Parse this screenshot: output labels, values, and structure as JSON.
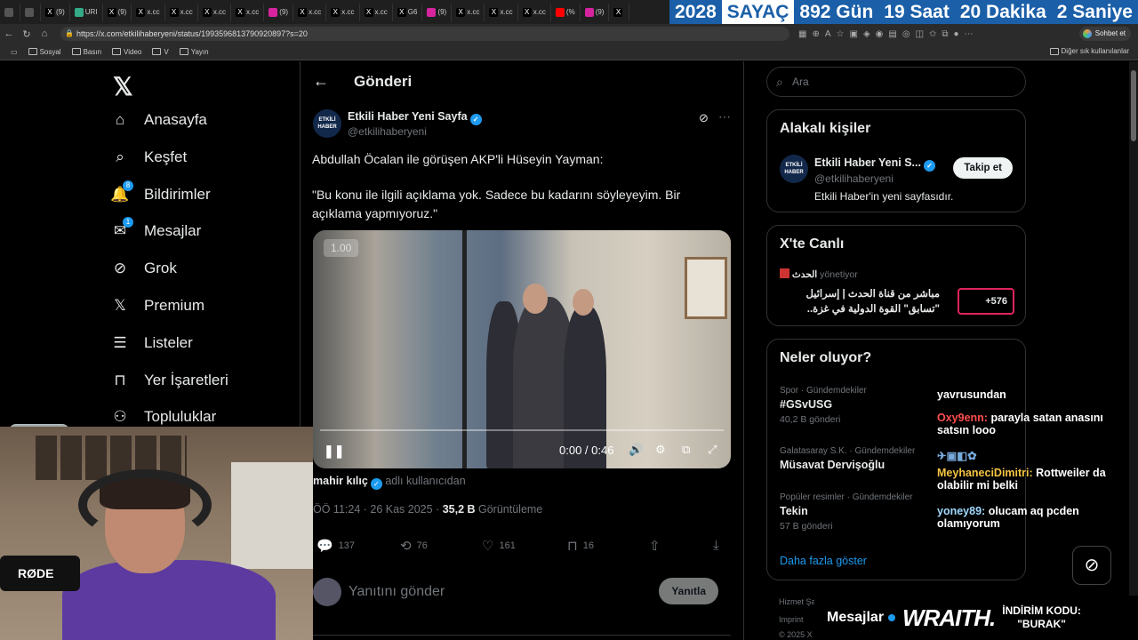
{
  "browser": {
    "tabs": [
      {
        "label": "",
        "icon": "window-icon"
      },
      {
        "label": "",
        "icon": "tabs-icon"
      },
      {
        "label": "(9)",
        "icon": "x-icon"
      },
      {
        "label": "URI",
        "icon": "tab-icon"
      },
      {
        "label": "(9)",
        "icon": "x-icon"
      },
      {
        "label": "x.cc",
        "icon": "x-icon"
      },
      {
        "label": "x.cc",
        "icon": "x-icon"
      },
      {
        "label": "x.cc",
        "icon": "x-icon"
      },
      {
        "label": "x.cc",
        "icon": "x-icon"
      },
      {
        "label": "(9)",
        "icon": "instagram-icon"
      },
      {
        "label": "x.cc",
        "icon": "x-icon"
      },
      {
        "label": "x.cc",
        "icon": "x-icon"
      },
      {
        "label": "x.cc",
        "icon": "x-icon"
      },
      {
        "label": "G6",
        "icon": "x-icon"
      },
      {
        "label": "(9)",
        "icon": "instagram-icon"
      },
      {
        "label": "x.cc",
        "icon": "x-icon"
      },
      {
        "label": "x.cc",
        "icon": "x-icon"
      },
      {
        "label": "x.cc",
        "icon": "x-icon"
      },
      {
        "label": "(%",
        "icon": "youtube-icon"
      },
      {
        "label": "(9)",
        "icon": "instagram-icon"
      },
      {
        "label": "",
        "icon": "x-icon"
      }
    ],
    "url": "https://x.com/etkilihaberyeni/status/1993596813790920897?s=20",
    "sohbet": "Sohbet et",
    "bookmarks": [
      "Sosyal",
      "Basın",
      "Video",
      "V",
      "Yayın"
    ],
    "bookmarks_right": "Diğer sık kullanılanlar"
  },
  "counter": {
    "year": "2028",
    "label": "SAYAÇ",
    "days": "892 Gün",
    "hours": "19 Saat",
    "minutes": "20 Dakika",
    "seconds": "2 Saniye"
  },
  "sidebar": {
    "items": [
      {
        "label": "Anasayfa",
        "icon": "home-icon"
      },
      {
        "label": "Keşfet",
        "icon": "search-icon"
      },
      {
        "label": "Bildirimler",
        "icon": "bell-icon",
        "badge": "8"
      },
      {
        "label": "Mesajlar",
        "icon": "mail-icon",
        "badge": "1"
      },
      {
        "label": "Grok",
        "icon": "grok-icon"
      },
      {
        "label": "Premium",
        "icon": "x-icon"
      },
      {
        "label": "Listeler",
        "icon": "list-icon"
      },
      {
        "label": "Yer İşaretleri",
        "icon": "bookmark-icon"
      },
      {
        "label": "Topluluklar",
        "icon": "people-icon"
      }
    ]
  },
  "post": {
    "header_title": "Gönderi",
    "avatar_text": "ETKİLİ HABER",
    "author_name": "Etkili Haber Yeni Sayfa",
    "author_handle": "@etkilihaberyeni",
    "text_1": "Abdullah Öcalan ile görüşen AKP'li Hüseyin Yayman:",
    "text_2": "\"Bu konu ile ilgili açıklama yok. Sadece bu kadarını söyleyeyim. Bir açıklama yapmıyoruz.\"",
    "video": {
      "speed": "1.00",
      "time": "0:00 / 0:46",
      "progress": 0.0
    },
    "byline_user": "mahir kılıç",
    "byline_rest": "adlı kullanıcıdan",
    "time": "ÖÖ 11:24 · 26 Kas 2025 · ",
    "views_count": "35,2 B",
    "views_label": " Görüntüleme",
    "stats": {
      "replies": "137",
      "reposts": "76",
      "likes": "161",
      "bookmarks": "16"
    },
    "reply_placeholder": "Yanıtını gönder",
    "reply_button": "Yanıtla"
  },
  "right": {
    "search_placeholder": "Ara",
    "related_title": "Alakalı kişiler",
    "related": {
      "name": "Etkili Haber Yeni S...",
      "handle": "@etkilihaberyeni",
      "bio": "Etkili Haber'in yeni sayfasıdır.",
      "follow": "Takip et",
      "avatar_text": "ETKİLİ HABER"
    },
    "live_title": "X'te Canlı",
    "live": {
      "host": "الحدث",
      "host_suffix": "yönetiyor",
      "title": "مباشر من قناة الحدث | إسرائيل \"تسابق\" القوة الدولية في غزة..",
      "count": "+576"
    },
    "trends_title": "Neler oluyor?",
    "trends": [
      {
        "category": "Spor · Gündemdekiler",
        "name": "#GSvUSG",
        "count": "40,2 B gönderi"
      },
      {
        "category": "Galatasaray S.K. · Gündemdekiler",
        "name": "Müsavat Dervişoğlu",
        "count": ""
      },
      {
        "category": "Popüler resimler · Gündemdekiler",
        "name": "Tekin",
        "count": "57 B gönderi"
      }
    ],
    "show_more": "Daha fazla göster",
    "footer": [
      "Hizmet Şa...",
      "Imprint",
      "© 2025 X"
    ]
  },
  "chat": {
    "lines": [
      {
        "user": "",
        "text": "yavrusundan"
      },
      {
        "user": "Oxy9enn:",
        "text": "parayla satan anasını satsın looo"
      },
      {
        "user": "MeyhaneciDimitri:",
        "text": "Rottweiler da olabilir mi belki"
      },
      {
        "user": "yoney89:",
        "text": "olucam aq pcden olamıyorum"
      }
    ]
  },
  "overlay": {
    "messages": "Mesajlar",
    "brand": "WRAITH.",
    "promo_1": "İNDİRİM KODU:",
    "promo_2": "\"BURAK\"",
    "mic_brand": "RØDE"
  }
}
